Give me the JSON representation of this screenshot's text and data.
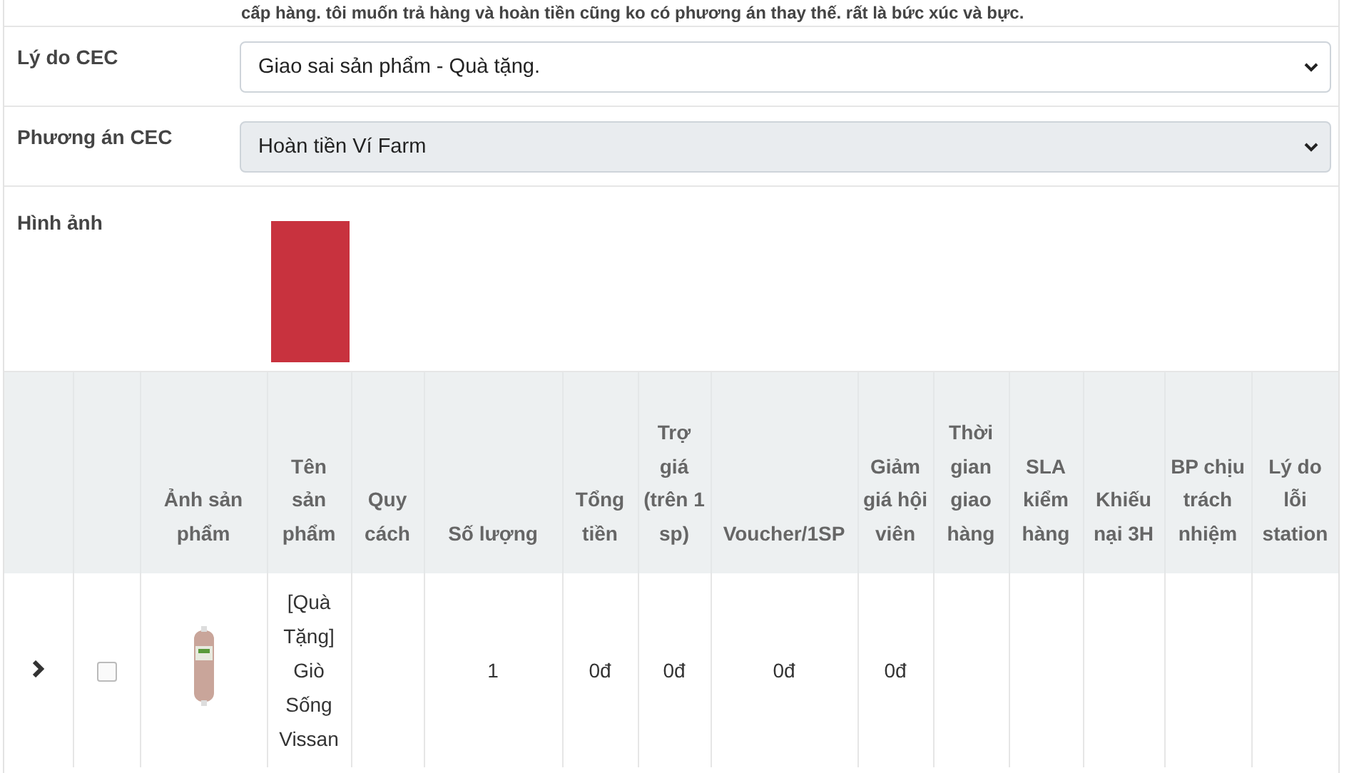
{
  "note": "cấp hàng. tôi muốn trả hàng và hoàn tiền cũng ko có phương án thay thế. rất là bức xúc và bực.",
  "fields": [
    {
      "label": "Lý do CEC",
      "value": "Giao sai sản phẩm - Quà tặng.",
      "disabled": false
    },
    {
      "label": "Phương án CEC",
      "value": "Hoàn tiền Ví Farm",
      "disabled": true
    }
  ],
  "images": {
    "label": "Hình ảnh"
  },
  "table": {
    "columns": [
      "",
      "",
      "Ảnh sản phẩm",
      "Tên sản phẩm",
      "Quy cách",
      "Số lượng",
      "Tổng tiền",
      "Trợ giá (trên 1 sp)",
      "Voucher/1SP",
      "Giảm giá hội viên",
      "Thời gian giao hàng",
      "SLA kiểm hàng",
      "Khiếu nại 3H",
      "BP chịu trách nhiệm",
      "Lý do lỗi station"
    ],
    "rows": [
      {
        "expanded": false,
        "checked": false,
        "name": "[Quà Tặng] Giò Sống Vissan",
        "spec": "",
        "quantity": "1",
        "total": "0đ",
        "subsidy": "0đ",
        "voucher": "0đ",
        "member_discount": "0đ"
      }
    ]
  }
}
